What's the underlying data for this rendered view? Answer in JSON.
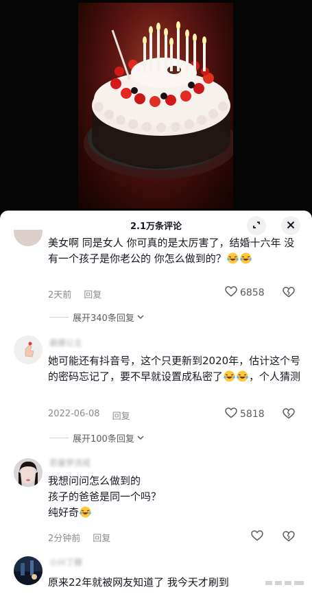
{
  "sheet": {
    "title": "2.1万条评论"
  },
  "comments": [
    {
      "username": "",
      "text": "美女啊  同是女人   你可真的是太厉害了，结婚十六年  没有一个孩子是你老公的  你怎么做到的？",
      "emoji_count": 2,
      "time": "2天前",
      "reply_label": "回复",
      "likes": "6858",
      "expand": "展开340条回复"
    },
    {
      "username": "晨娜公主",
      "text": "她可能还有抖音号，这个只更新到2020年，估计这个号的密码忘记了，要不早就设置成私密了",
      "text_tail": "，个人猜测",
      "time": "2022-06-08",
      "reply_label": "回复",
      "likes": "5818",
      "expand": "展开100条回复"
    },
    {
      "username": "若曼梦流戒",
      "lines": [
        "我想问问怎么做到的",
        "孩子的爸爸是同一个吗？",
        "纯好奇"
      ],
      "time": "2分钟前",
      "reply_label": "回复"
    },
    {
      "username": "小兴丁腰",
      "text": "原来22年就被网友知道了 我今天才刷到"
    }
  ],
  "icons": {
    "expand": "fullscreen-icon",
    "close": "close-icon",
    "like": "heart-outline-icon",
    "dislike": "broken-heart-icon",
    "emoji": "laugh-cry-emoji"
  }
}
